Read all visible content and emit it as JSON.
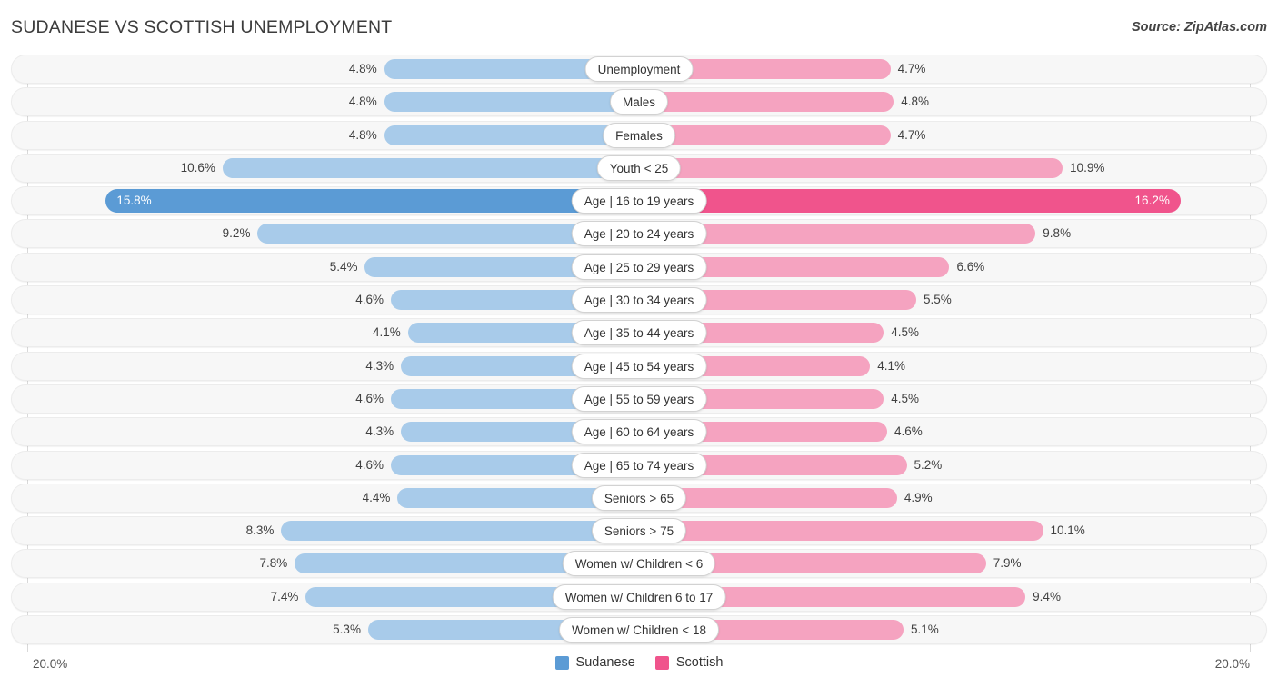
{
  "header": {
    "title": "SUDANESE VS SCOTTISH UNEMPLOYMENT",
    "source": "Source: ZipAtlas.com"
  },
  "footer": {
    "axis_left": "20.0%",
    "axis_right": "20.0%"
  },
  "legend": [
    {
      "label": "Sudanese",
      "color": "#5b9bd5"
    },
    {
      "label": "Scottish",
      "color": "#f0548c"
    }
  ],
  "colors": {
    "left_normal": "#a8cbea",
    "right_normal": "#f5a3c0",
    "left_highlight": "#5b9bd5",
    "right_highlight": "#f0548c",
    "track": "#f7f7f7",
    "gridline": "#d9d9d9"
  },
  "chart_data": {
    "type": "bar",
    "title": "SUDANESE VS SCOTTISH UNEMPLOYMENT",
    "subtitle": "",
    "xlabel": "",
    "ylabel": "",
    "orientation": "horizontal",
    "layout": "diverging-bidirectional",
    "grid": true,
    "legend_position": "bottom-center",
    "axis_max_label": "20.0%",
    "axis_range": [
      0,
      20.0
    ],
    "categories": [
      "Unemployment",
      "Males",
      "Females",
      "Youth < 25",
      "Age | 16 to 19 years",
      "Age | 20 to 24 years",
      "Age | 25 to 29 years",
      "Age | 30 to 34 years",
      "Age | 35 to 44 years",
      "Age | 45 to 54 years",
      "Age | 55 to 59 years",
      "Age | 60 to 64 years",
      "Age | 65 to 74 years",
      "Seniors > 65",
      "Seniors > 75",
      "Women w/ Children < 6",
      "Women w/ Children 6 to 17",
      "Women w/ Children < 18"
    ],
    "series": [
      {
        "name": "Sudanese",
        "side": "left",
        "color": "#5b9bd5",
        "values": [
          4.8,
          4.8,
          4.8,
          10.6,
          15.8,
          9.2,
          5.4,
          4.6,
          4.1,
          4.3,
          4.6,
          4.3,
          4.6,
          4.4,
          8.3,
          7.8,
          7.4,
          5.3
        ],
        "labels": [
          "4.8%",
          "4.8%",
          "4.8%",
          "10.6%",
          "15.8%",
          "9.2%",
          "5.4%",
          "4.6%",
          "4.1%",
          "4.3%",
          "4.6%",
          "4.3%",
          "4.6%",
          "4.4%",
          "8.3%",
          "7.8%",
          "7.4%",
          "5.3%"
        ]
      },
      {
        "name": "Scottish",
        "side": "right",
        "color": "#f0548c",
        "values": [
          4.7,
          4.8,
          4.7,
          10.9,
          16.2,
          9.8,
          6.6,
          5.5,
          4.5,
          4.1,
          4.5,
          4.6,
          5.2,
          4.9,
          10.1,
          7.9,
          9.4,
          5.1
        ],
        "labels": [
          "4.7%",
          "4.8%",
          "4.7%",
          "10.9%",
          "16.2%",
          "9.8%",
          "6.6%",
          "5.5%",
          "4.5%",
          "4.1%",
          "4.5%",
          "4.6%",
          "5.2%",
          "4.9%",
          "10.1%",
          "7.9%",
          "9.4%",
          "5.1%"
        ]
      }
    ],
    "highlighted_category": "Age | 16 to 19 years"
  }
}
